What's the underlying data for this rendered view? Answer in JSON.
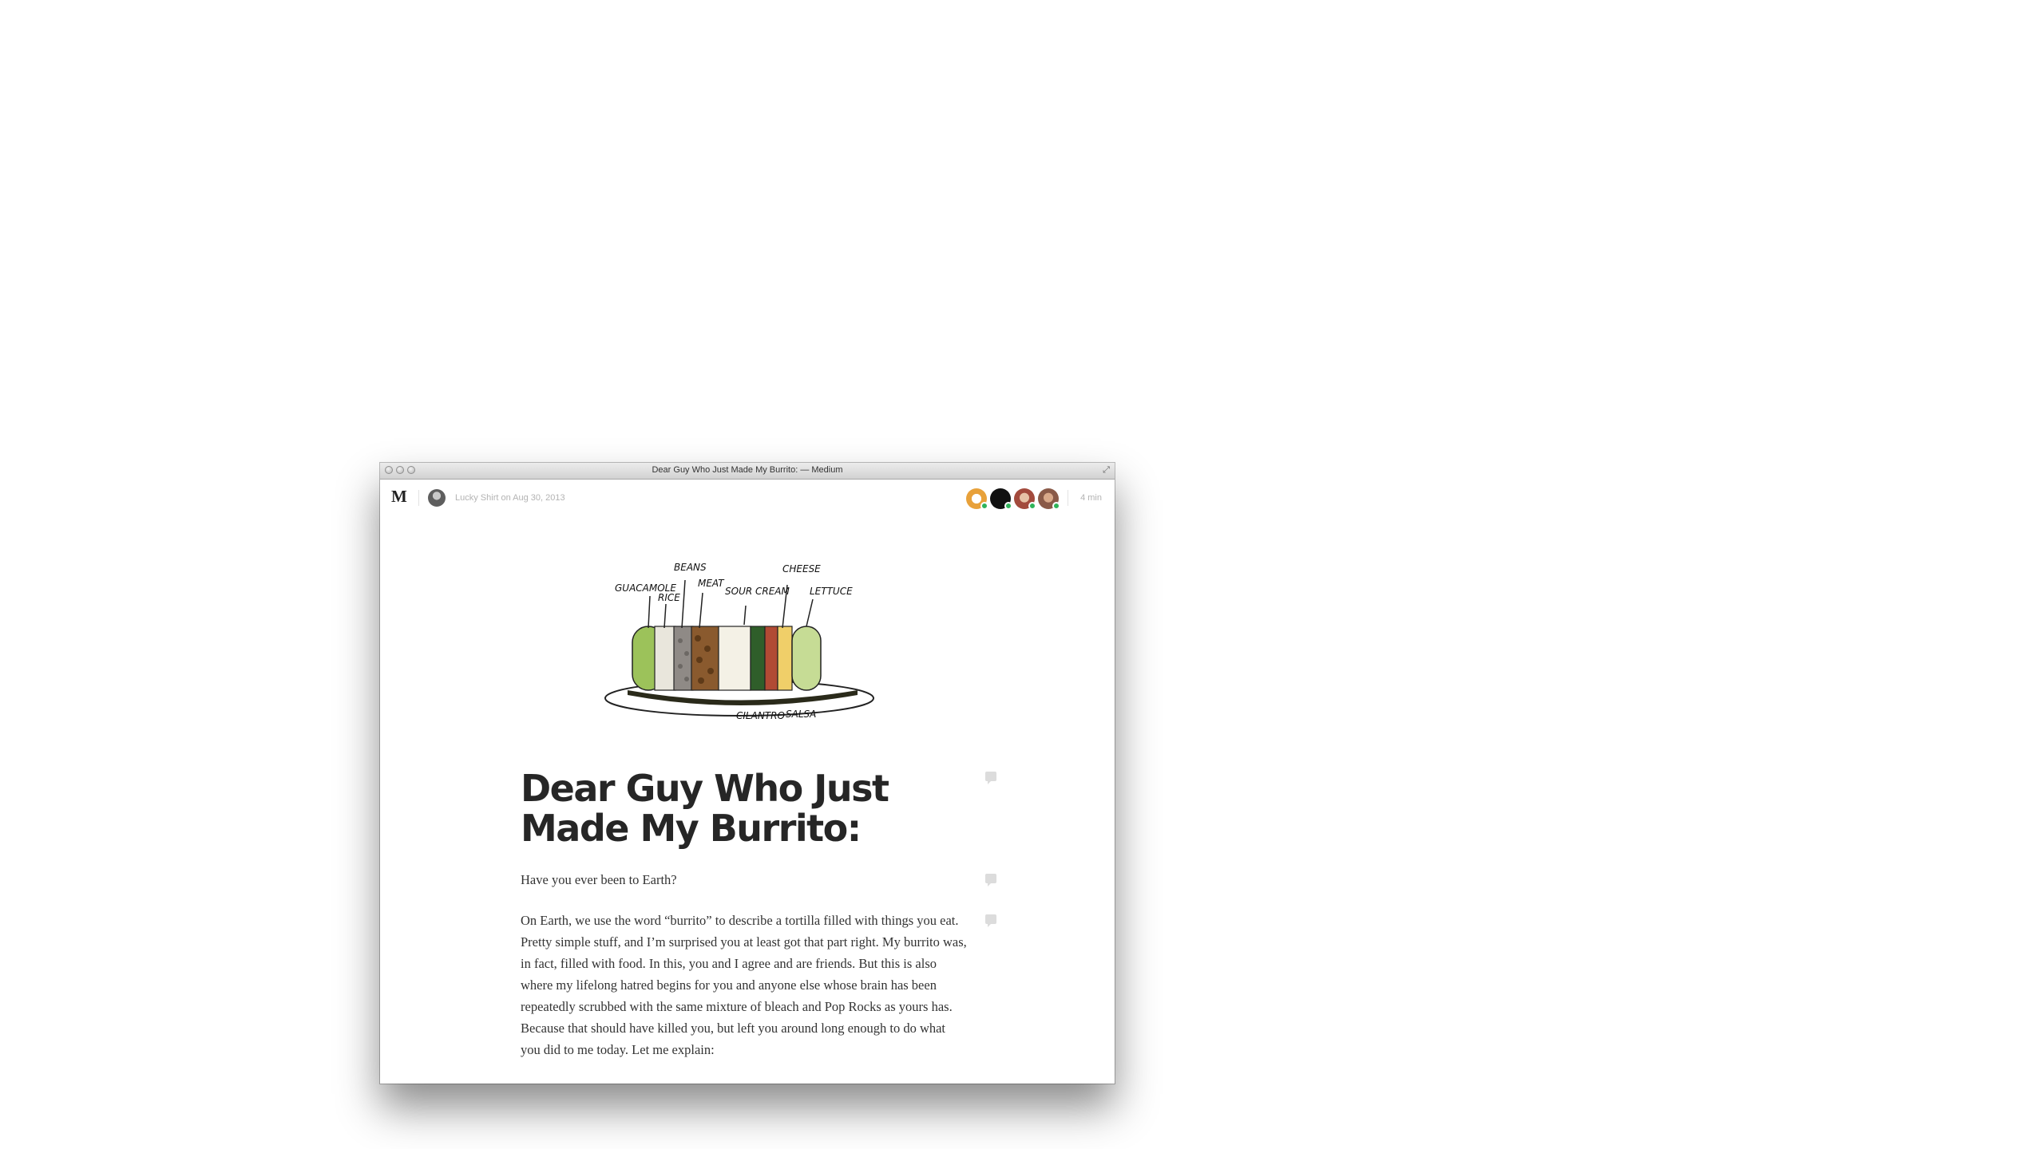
{
  "window": {
    "title": "Dear Guy Who Just Made My Burrito: — Medium"
  },
  "topbar": {
    "logo": "M",
    "byline": "Lucky Shirt on Aug 30, 2013",
    "read_time": "4 min",
    "recommenders": [
      {
        "icon": "recommender-avatar-1",
        "color": "#e8a13a"
      },
      {
        "icon": "recommender-avatar-2",
        "color": "#111111"
      },
      {
        "icon": "recommender-avatar-3",
        "color": "#a34a3c"
      },
      {
        "icon": "recommender-avatar-4",
        "color": "#8a5a48"
      }
    ]
  },
  "illustration": {
    "labels": [
      "BEANS",
      "GUACAMOLE",
      "RICE",
      "MEAT",
      "SOUR CREAM",
      "CHEESE",
      "LETTUCE",
      "CILANTRO",
      "SALSA"
    ]
  },
  "article": {
    "title": "Dear Guy Who Just Made My Burrito:",
    "paragraphs": [
      "Have you ever been to Earth?",
      "On Earth, we use the word “burrito” to describe a tortilla filled with things you eat. Pretty simple stuff, and I’m surprised you at least got that part right. My burrito was, in fact, filled with food. In this, you and I agree and are friends. But this is also where my lifelong hatred begins for you and anyone else whose brain has been repeatedly scrubbed with the same mixture of bleach and Pop Rocks as yours has. Because that should have killed you, but left you around long enough to do what you did to me today. Let me explain:"
    ]
  }
}
